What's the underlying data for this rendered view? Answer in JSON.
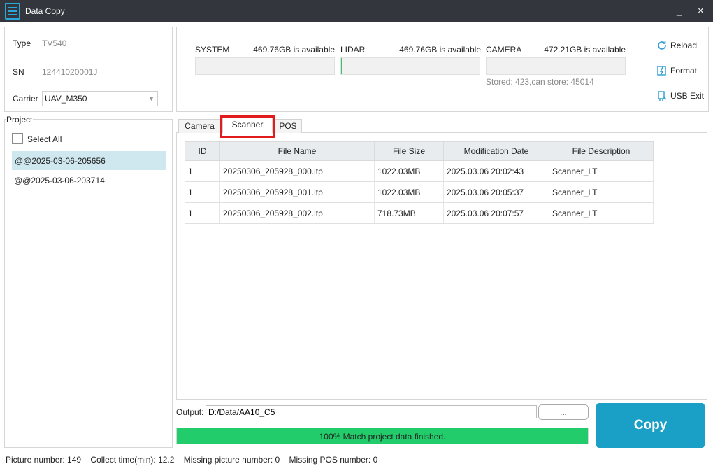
{
  "window": {
    "title": "Data Copy",
    "minimize": "_",
    "close": "×"
  },
  "device": {
    "type_label": "Type",
    "type_value": "TV540",
    "sn_label": "SN",
    "sn_value": "12441020001J",
    "carrier_label": "Carrier",
    "carrier_value": "UAV_M350"
  },
  "storage": [
    {
      "name": "SYSTEM",
      "available": "469.76GB is available",
      "fill_fraction": 0.005
    },
    {
      "name": "LIDAR",
      "available": "469.76GB is available",
      "fill_fraction": 0.005
    },
    {
      "name": "CAMERA",
      "available": "472.21GB is available",
      "fill_fraction": 0.005
    }
  ],
  "stored_note": "Stored: 423,can store: 45014",
  "actions": {
    "reload": "Reload",
    "format": "Format",
    "usb_exit": "USB Exit"
  },
  "project": {
    "title": "Project",
    "select_all": "Select All",
    "items": [
      "@@2025-03-06-205656",
      "@@2025-03-06-203714"
    ],
    "selected_index": 0
  },
  "tabs": [
    "Camera",
    "Scanner",
    "POS"
  ],
  "active_tab": "Scanner",
  "table": {
    "headers": [
      "ID",
      "File Name",
      "File Size",
      "Modification Date",
      "File Description"
    ],
    "rows": [
      [
        "1",
        "20250306_205928_000.ltp",
        "1022.03MB",
        "2025.03.06 20:02:43",
        "Scanner_LT"
      ],
      [
        "1",
        "20250306_205928_001.ltp",
        "1022.03MB",
        "2025.03.06 20:05:37",
        "Scanner_LT"
      ],
      [
        "1",
        "20250306_205928_002.ltp",
        "718.73MB",
        "2025.03.06 20:07:57",
        "Scanner_LT"
      ]
    ]
  },
  "output": {
    "label": "Output:",
    "path": "D:/Data/AA10_C5",
    "browse": "..."
  },
  "progress": {
    "percent": 100,
    "text": "100% Match project data finished."
  },
  "copy_label": "Copy",
  "status_bar": [
    "Picture number: 149",
    "Collect time(min): 12.2",
    "Missing picture number: 0",
    "Missing POS number: 0"
  ],
  "colors": {
    "accent": "#1aa0c7",
    "progress": "#22cc6a",
    "titlebar": "#33373d",
    "highlight": "#e21c1c",
    "selected_row": "#cfe8ef"
  }
}
